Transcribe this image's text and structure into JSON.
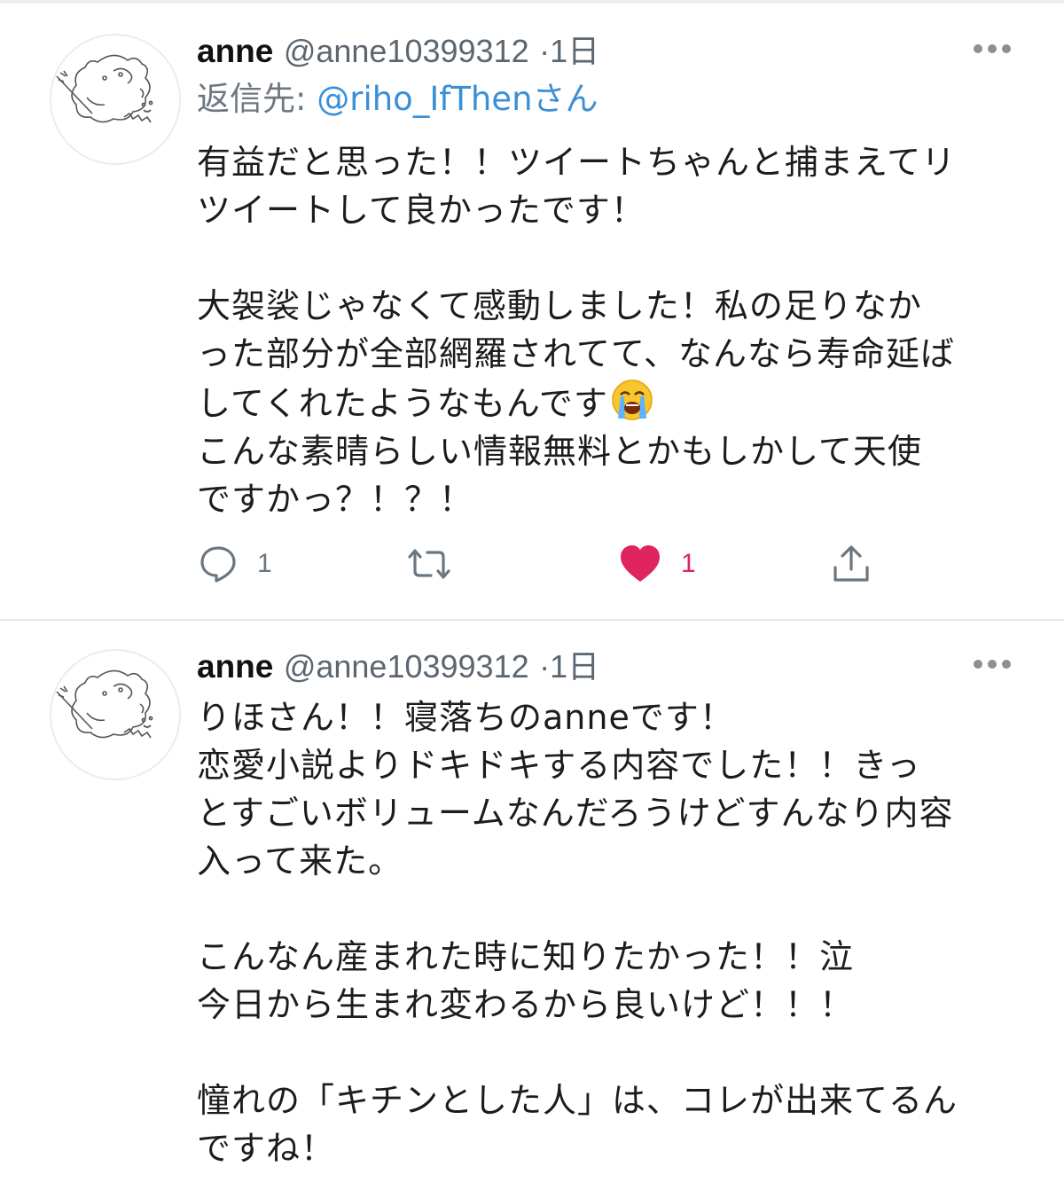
{
  "tweets": [
    {
      "display_name": "anne",
      "handle": "@anne10399312",
      "separator": "·",
      "time": "1日",
      "reply_to_prefix": "返信先: ",
      "reply_to_mention": "@riho_IfThenさん",
      "text_before_emoji": "有益だと思った！！ツイートちゃんと捕まえてリ\nツイートして良かったです！\n\n大袈裟じゃなくて感動しました！私の足りなか\nった部分が全部網羅されてて、なんなら寿命延ば\nしてくれたようなもんです",
      "emoji": "loudly-crying-face",
      "text_after_emoji": "\nこんな素晴らしい情報無料とかもしかして天使\nですかっ？！？！",
      "reply_count": "1",
      "like_count": "1",
      "liked": true
    },
    {
      "display_name": "anne",
      "handle": "@anne10399312",
      "separator": "·",
      "time": "1日",
      "text": "りほさん！！寝落ちのanneです！\n恋愛小説よりドキドキする内容でした！！きっ\nとすごいボリュームなんだろうけどすんなり内容\n入って来た。\n\nこんなん産まれた時に知りたかった！！泣\n今日から生まれ変わるから良いけど！！！\n\n憧れの「キチンとした人」は、コレが出来てるん\nですね！"
    }
  ],
  "colors": {
    "link": "#3b8fd6",
    "like": "#e0245e",
    "secondary_text": "#5b6670",
    "divider": "#e6e6e6"
  },
  "icons": {
    "more": "more-horizontal-icon",
    "reply": "reply-bubble-icon",
    "retweet": "retweet-icon",
    "like": "heart-icon",
    "share": "share-icon"
  }
}
